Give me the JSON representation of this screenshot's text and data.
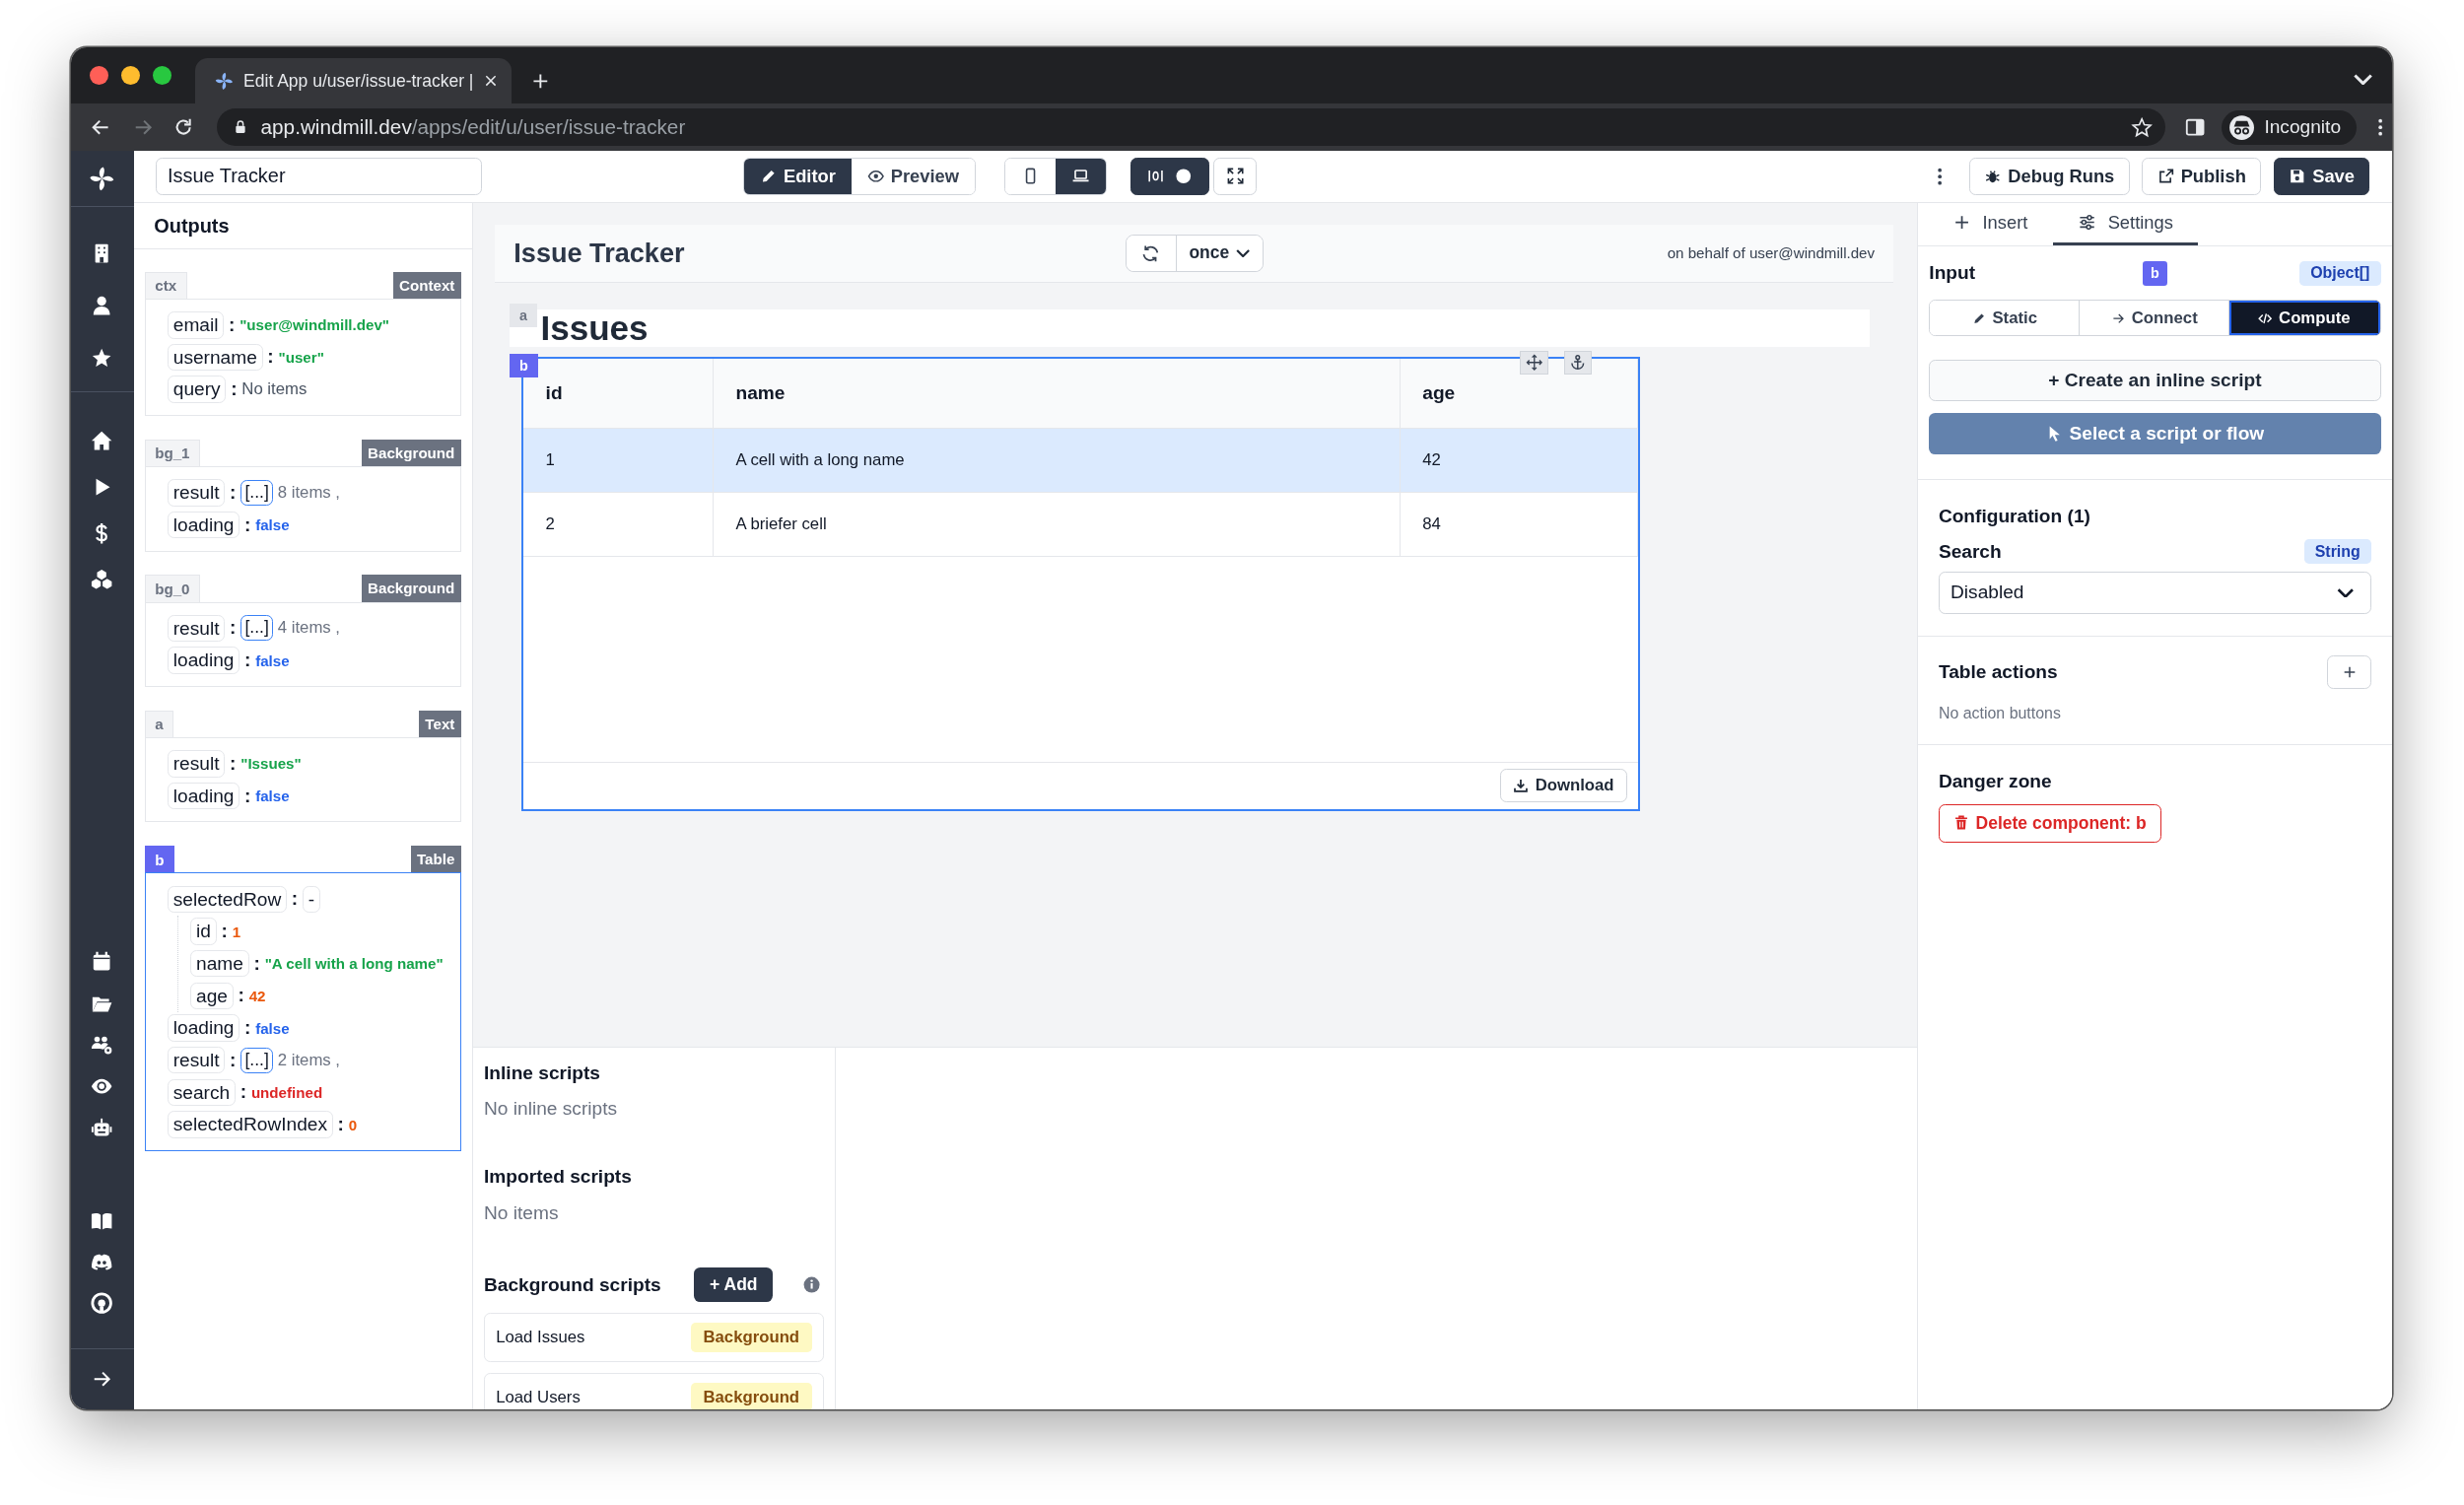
{
  "browser": {
    "tab_title": "Edit App u/user/issue-tracker |",
    "url_host": "app.windmill.dev",
    "url_path": "/apps/edit/u/user/issue-tracker",
    "profile": "Incognito"
  },
  "header": {
    "app_name": "Issue Tracker",
    "modes": [
      {
        "label": "Editor",
        "selected": true
      },
      {
        "label": "Preview",
        "selected": false
      }
    ],
    "devices": [
      {
        "selected": false
      },
      {
        "selected": true
      }
    ],
    "actions": [
      "Debug Runs",
      "Publish",
      "Save"
    ]
  },
  "outputs": {
    "title": "Outputs",
    "separator": ":",
    "groups": [
      {
        "id": "ctx",
        "type": "Context",
        "selected": false,
        "fields": [
          {
            "key": "email",
            "kind": "string",
            "value": "\"user@windmill.dev\""
          },
          {
            "key": "username",
            "kind": "string",
            "value": "\"user\""
          },
          {
            "key": "query",
            "kind": "plain",
            "value": "No items"
          }
        ]
      },
      {
        "id": "bg_1",
        "type": "Background",
        "selected": false,
        "fields": [
          {
            "key": "result",
            "kind": "array",
            "value": "[...]",
            "count": "8 items ,"
          },
          {
            "key": "loading",
            "kind": "boolean",
            "value": "false"
          }
        ]
      },
      {
        "id": "bg_0",
        "type": "Background",
        "selected": false,
        "fields": [
          {
            "key": "result",
            "kind": "array",
            "value": "[...]",
            "count": "4 items ,"
          },
          {
            "key": "loading",
            "kind": "boolean",
            "value": "false"
          }
        ]
      },
      {
        "id": "a",
        "type": "Text",
        "selected": false,
        "fields": [
          {
            "key": "result",
            "kind": "string",
            "value": "\"Issues\""
          },
          {
            "key": "loading",
            "kind": "boolean",
            "value": "false"
          }
        ]
      },
      {
        "id": "b",
        "type": "Table",
        "selected": true,
        "fields": [
          {
            "key": "selectedRow",
            "kind": "object",
            "value": "-",
            "children": [
              {
                "key": "id",
                "kind": "number",
                "value": "1"
              },
              {
                "key": "name",
                "kind": "string",
                "value": "\"A cell with a long name\""
              },
              {
                "key": "age",
                "kind": "number",
                "value": "42"
              }
            ]
          },
          {
            "key": "loading",
            "kind": "boolean",
            "value": "false"
          },
          {
            "key": "result",
            "kind": "array",
            "value": "[...]",
            "count": "2 items ,"
          },
          {
            "key": "search",
            "kind": "undefined",
            "value": "undefined"
          },
          {
            "key": "selectedRowIndex",
            "kind": "number",
            "value": "0"
          }
        ]
      }
    ]
  },
  "canvas": {
    "title": "Issue Tracker",
    "refresh": "once",
    "behalf": "on behalf of user@windmill.dev",
    "text_component": {
      "id": "a",
      "selected": false,
      "text": "Issues"
    },
    "table": {
      "id": "b",
      "selected": true,
      "columns": [
        "id",
        "name",
        "age"
      ],
      "rows": [
        {
          "cells": [
            "1",
            "A cell with a long name",
            "42"
          ],
          "selected": true
        },
        {
          "cells": [
            "2",
            "A briefer cell",
            "84"
          ],
          "selected": false
        }
      ],
      "download": "Download"
    }
  },
  "scripts": {
    "inline": {
      "title": "Inline scripts",
      "empty": "No inline scripts"
    },
    "imported": {
      "title": "Imported scripts",
      "empty": "No items"
    },
    "background": {
      "title": "Background scripts",
      "add": "+ Add",
      "items": [
        {
          "name": "Load Issues",
          "tag": "Background"
        },
        {
          "name": "Load Users",
          "tag": "Background"
        }
      ]
    }
  },
  "settings": {
    "tabs": [
      {
        "label": "Insert",
        "selected": false
      },
      {
        "label": "Settings",
        "selected": true
      }
    ],
    "input": {
      "label": "Input",
      "component": "b",
      "type": "Object[]",
      "modes": [
        {
          "label": "Static",
          "selected": false
        },
        {
          "label": "Connect",
          "selected": false
        },
        {
          "label": "Compute",
          "selected": true
        }
      ],
      "create": "+ Create an inline script",
      "select": "Select a script or flow"
    },
    "configuration": {
      "title": "Configuration (1)",
      "fields": [
        {
          "label": "Search",
          "type": "String",
          "value": "Disabled"
        }
      ]
    },
    "table_actions": {
      "title": "Table actions",
      "empty": "No action buttons"
    },
    "danger": {
      "title": "Danger zone",
      "delete": "Delete component: b"
    }
  }
}
